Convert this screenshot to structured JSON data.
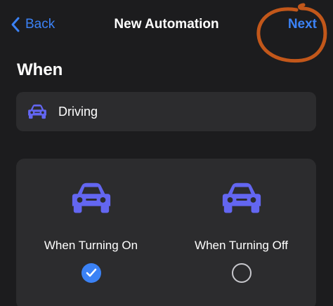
{
  "nav": {
    "back_label": "Back",
    "title": "New Automation",
    "next_label": "Next"
  },
  "section": {
    "heading": "When"
  },
  "trigger": {
    "icon": "car-icon",
    "label": "Driving"
  },
  "options": [
    {
      "icon": "car-icon",
      "label": "When Turning On",
      "selected": true
    },
    {
      "icon": "car-icon",
      "label": "When Turning Off",
      "selected": false
    }
  ],
  "colors": {
    "background": "#1c1c1e",
    "card": "#2c2c2e",
    "accent": "#3b82f6",
    "icon": "#6366f1",
    "annotation": "#c2571a"
  }
}
